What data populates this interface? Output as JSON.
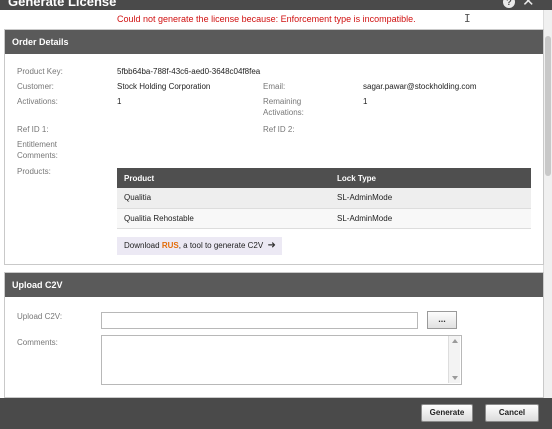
{
  "dialog": {
    "title": "Generate License",
    "help_icon": "question-circle-icon",
    "close_icon": "close-x-icon",
    "error_message": "Could not generate the license because: Enforcement type is incompatible."
  },
  "order_details": {
    "heading": "Order Details",
    "product_key_label": "Product Key:",
    "product_key": "5fbb64ba-788f-43c6-aed0-3648c04f8fea",
    "customer_label": "Customer:",
    "customer": "Stock Holding Corporation",
    "email_label": "Email:",
    "email": "sagar.pawar@stockholding.com",
    "activations_label": "Activations:",
    "activations": "1",
    "remaining_label_line1": "Remaining",
    "remaining_label_line2": "Activations:",
    "remaining": "1",
    "ref1_label": "Ref ID 1:",
    "ref2_label": "Ref ID 2:",
    "entitlement_label_line1": "Entitlement",
    "entitlement_label_line2": "Comments:",
    "products_label": "Products:",
    "products_table": {
      "headers": [
        "Product",
        "Lock Type"
      ],
      "rows": [
        [
          "Qualitia",
          "SL-AdminMode"
        ],
        [
          "Qualitia Rehostable",
          "SL-AdminMode"
        ]
      ]
    },
    "download": {
      "prefix": "Download",
      "highlight": "RUS",
      "suffix": ", a tool to generate C2V",
      "arrow_icon": "arrow-right-icon"
    }
  },
  "upload_c2v": {
    "heading": "Upload C2V",
    "upload_label": "Upload C2V:",
    "upload_value": "",
    "browse_label": "...",
    "comments_label": "Comments:",
    "comments_value": ""
  },
  "footer": {
    "generate_label": "Generate",
    "cancel_label": "Cancel"
  },
  "colors": {
    "error_red": "#d01010",
    "header_dark": "#4a4a4a",
    "rus_orange": "#e36c09"
  }
}
